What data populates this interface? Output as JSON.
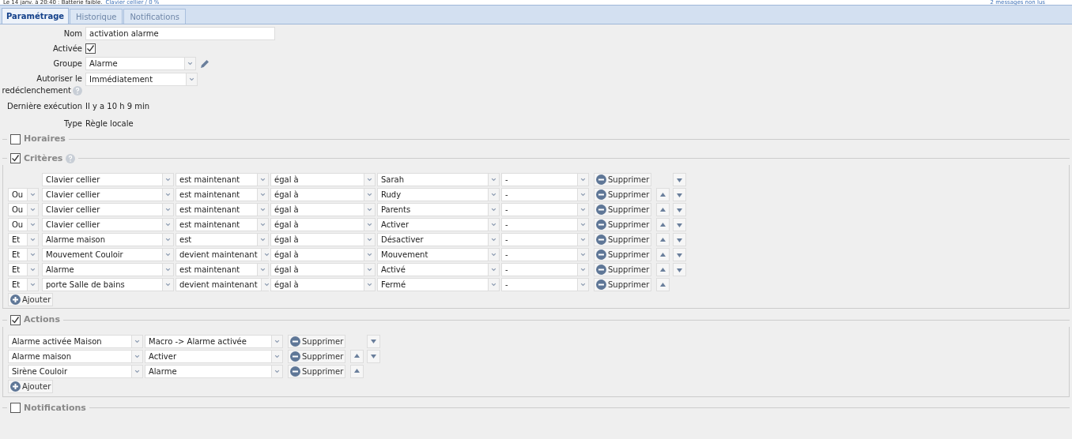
{
  "notice": {
    "text": "Le 14 janv. à 20:40 : Batterie faible.",
    "link": "Clavier cellier / 0 %",
    "messages": "2 messages non lus"
  },
  "tabs": [
    {
      "label": "Paramétrage",
      "selected": true
    },
    {
      "label": "Historique",
      "selected": false
    },
    {
      "label": "Notifications",
      "selected": false
    }
  ],
  "form": {
    "name_label": "Nom",
    "name_value": "activation alarme",
    "enabled_label": "Activée",
    "enabled": true,
    "group_label": "Groupe",
    "group_value": "Alarme",
    "retrigger_label_1": "Autoriser le",
    "retrigger_label_2": "redéclenchement",
    "retrigger_value": "Immédiatement",
    "last_run_label": "Dernière exécution",
    "last_run_value": "Il y a 10 h 9 min",
    "type_label": "Type",
    "type_value": "Règle locale"
  },
  "schedules": {
    "title": "Horaires",
    "checked": false
  },
  "criteria": {
    "title": "Critères",
    "checked": true,
    "add_label": "Ajouter",
    "rows": [
      {
        "conj": null,
        "device": "Clavier cellier",
        "verb": "est maintenant",
        "comparator": "égal à",
        "value": "Sarah",
        "extra": "-",
        "delete": "Supprimer",
        "up": false,
        "down": true
      },
      {
        "conj": "Ou",
        "device": "Clavier cellier",
        "verb": "est maintenant",
        "comparator": "égal à",
        "value": "Rudy",
        "extra": "-",
        "delete": "Supprimer",
        "up": true,
        "down": true
      },
      {
        "conj": "Ou",
        "device": "Clavier cellier",
        "verb": "est maintenant",
        "comparator": "égal à",
        "value": "Parents",
        "extra": "-",
        "delete": "Supprimer",
        "up": true,
        "down": true
      },
      {
        "conj": "Ou",
        "device": "Clavier cellier",
        "verb": "est maintenant",
        "comparator": "égal à",
        "value": "Activer",
        "extra": "-",
        "delete": "Supprimer",
        "up": true,
        "down": true
      },
      {
        "conj": "Et",
        "device": "Alarme maison",
        "verb": "est",
        "comparator": "égal à",
        "value": "Désactiver",
        "extra": "-",
        "delete": "Supprimer",
        "up": true,
        "down": true
      },
      {
        "conj": "Et",
        "device": "Mouvement Couloir",
        "verb": "devient maintenant",
        "comparator": "égal à",
        "value": "Mouvement",
        "extra": "-",
        "delete": "Supprimer",
        "up": true,
        "down": true
      },
      {
        "conj": "Et",
        "device": "Alarme",
        "verb": "est maintenant",
        "comparator": "égal à",
        "value": "Activé",
        "extra": "-",
        "delete": "Supprimer",
        "up": true,
        "down": true
      },
      {
        "conj": "Et",
        "device": "porte Salle de bains",
        "verb": "devient maintenant",
        "comparator": "égal à",
        "value": "Fermé",
        "extra": "-",
        "delete": "Supprimer",
        "up": true,
        "down": false
      }
    ]
  },
  "actions": {
    "title": "Actions",
    "checked": true,
    "add_label": "Ajouter",
    "rows": [
      {
        "device": "Alarme activée Maison",
        "command": "Macro -> Alarme activée",
        "delete": "Supprimer",
        "up": false,
        "down": true
      },
      {
        "device": "Alarme maison",
        "command": "Activer",
        "delete": "Supprimer",
        "up": true,
        "down": true
      },
      {
        "device": "Sirène Couloir",
        "command": "Alarme",
        "delete": "Supprimer",
        "up": true,
        "down": false
      }
    ]
  },
  "notifications": {
    "title": "Notifications",
    "checked": false
  }
}
